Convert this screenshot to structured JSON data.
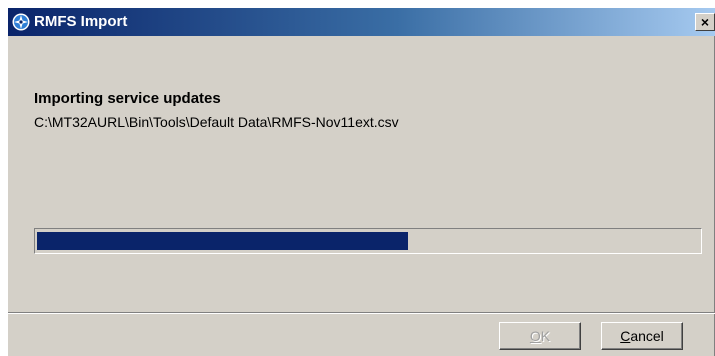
{
  "window": {
    "title": "RMFS Import",
    "close_glyph": "×",
    "app_icon": "rmfs-app-icon"
  },
  "content": {
    "heading": "Importing service updates",
    "file_path": "C:\\MT32AURL\\Bin\\Tools\\Default Data\\RMFS-Nov11ext.csv"
  },
  "progress": {
    "percent": 56
  },
  "buttons": {
    "ok_access_key": "O",
    "ok_rest": "K",
    "cancel_access_key": "C",
    "cancel_rest": "ancel"
  },
  "colors": {
    "title_bar_start": "#0a246a",
    "progress_fill": "#0a246a",
    "dialog_face": "#d4d0c8"
  }
}
